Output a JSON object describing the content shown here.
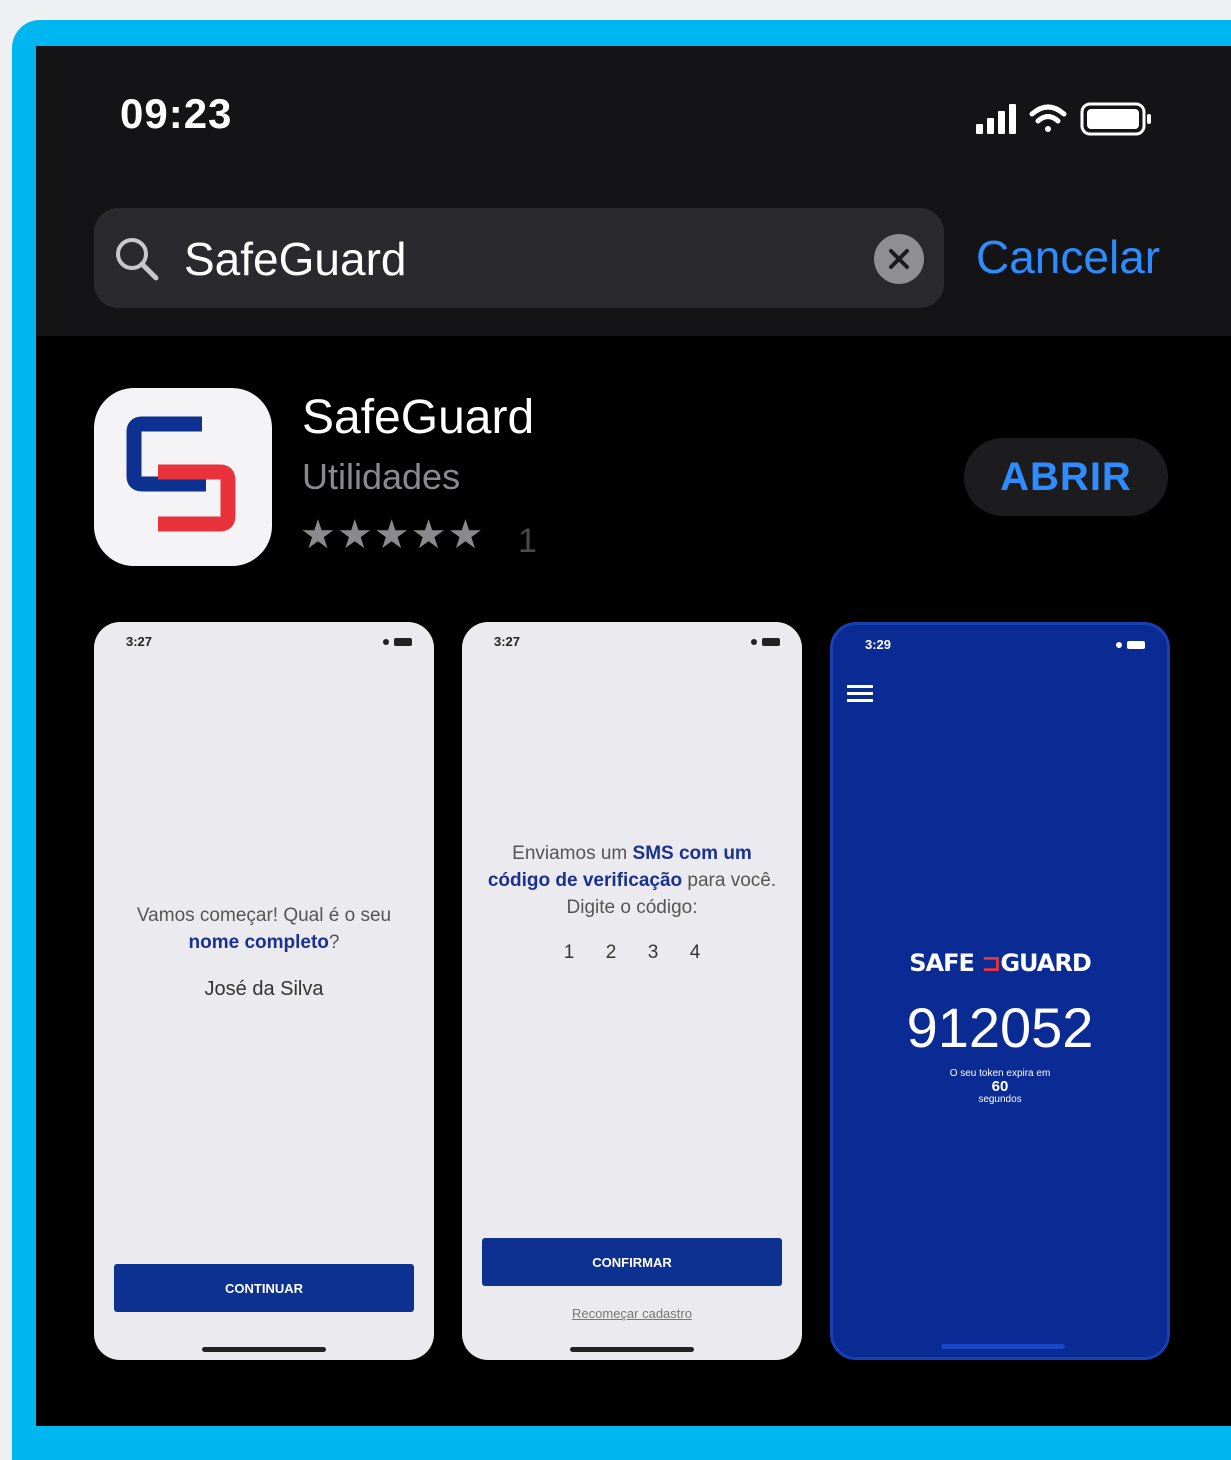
{
  "status_bar": {
    "time": "09:23"
  },
  "search": {
    "query": "SafeGuard",
    "cancel_label": "Cancelar"
  },
  "app": {
    "name": "SafeGuard",
    "category": "Utilidades",
    "stars": "★★★★★",
    "rating_value": 5,
    "rating_count": "1",
    "open_label": "ABRIR"
  },
  "screenshots": [
    {
      "time": "3:27",
      "question_pre": "Vamos começar! Qual é o seu",
      "question_bold": "nome completo",
      "question_post": "?",
      "name_value": "José da Silva",
      "button_label": "CONTINUAR"
    },
    {
      "time": "3:27",
      "line_pre": "Enviamos um",
      "line_bold": "SMS com um código de verificação",
      "line_post": "para você. Digite o código:",
      "code_digits": [
        "1",
        "2",
        "3",
        "4"
      ],
      "button_label": "CONFIRMAR",
      "link_label": "Recomeçar cadastro"
    },
    {
      "time": "3:29",
      "brand_left": "SAFE",
      "brand_right": "GUARD",
      "token": "912052",
      "expire_pre": "O seu token expira em",
      "expire_seconds": "60",
      "expire_post": "segundos"
    }
  ],
  "colors": {
    "frame": "#00b6f0",
    "accent_blue": "#2f8cff",
    "brand_blue": "#0d3190",
    "brand_red": "#e8323c"
  },
  "icons": [
    "signal-icon",
    "wifi-icon",
    "battery-icon",
    "search-icon",
    "clear-icon",
    "star-icon",
    "menu-icon"
  ]
}
